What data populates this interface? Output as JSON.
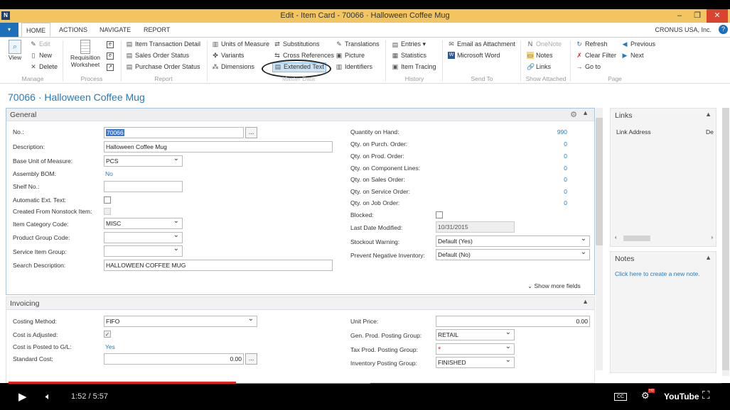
{
  "window": {
    "title": "Edit - Item Card - 70066 · Halloween Coffee Mug",
    "minimize": "–",
    "maximize": "❐",
    "close": "✕"
  },
  "ribbon_tabs": {
    "file": "▾",
    "home": "HOME",
    "actions": "ACTIONS",
    "navigate": "NAVIGATE",
    "report": "REPORT",
    "company": "CRONUS USA, Inc.",
    "help": "?"
  },
  "ribbon": {
    "manage": {
      "label": "Manage",
      "view": "View",
      "edit": "Edit",
      "new": "New",
      "delete": "Delete"
    },
    "process": {
      "label": "Process",
      "requisition": "Requisition\nWorksheet"
    },
    "report": {
      "label": "Report",
      "item_transaction_detail": "Item Transaction Detail",
      "sales_order_status": "Sales Order Status",
      "purchase_order_status": "Purchase Order Status"
    },
    "master_data": {
      "label": "Master Data",
      "units_of_measure": "Units of Measure",
      "variants": "Variants",
      "dimensions": "Dimensions",
      "substitutions": "Substitutions",
      "cross_references": "Cross References",
      "extended_text": "Extended Text",
      "translations": "Translations",
      "picture": "Picture",
      "identifiers": "Identifiers"
    },
    "history": {
      "label": "History",
      "entries": "Entries ▾",
      "statistics": "Statistics",
      "item_tracing": "Item Tracing"
    },
    "send_to": {
      "label": "Send To",
      "email_attachment": "Email as Attachment",
      "microsoft_word": "Microsoft Word"
    },
    "show_attached": {
      "label": "Show Attached",
      "onenote": "OneNote",
      "notes": "Notes",
      "links": "Links"
    },
    "page": {
      "label": "Page",
      "refresh": "Refresh",
      "clear_filter": "Clear Filter",
      "go_to": "Go to",
      "previous": "Previous",
      "next": "Next"
    }
  },
  "page_title": "70066 · Halloween Coffee Mug",
  "general": {
    "title": "General",
    "no_label": "No.:",
    "no_value": "70066",
    "no_dots": "...",
    "description_label": "Description:",
    "description_value": "Halloween Coffee Mug",
    "base_uom_label": "Base Unit of Measure:",
    "base_uom_value": "PCS",
    "assembly_bom_label": "Assembly BOM:",
    "assembly_bom_value": "No",
    "shelf_no_label": "Shelf No.:",
    "shelf_no_value": "",
    "auto_ext_text_label": "Automatic Ext. Text:",
    "created_nonstock_label": "Created From Nonstock Item:",
    "item_category_label": "Item Category Code:",
    "item_category_value": "MISC",
    "product_group_label": "Product Group Code:",
    "product_group_value": "",
    "service_item_group_label": "Service Item Group:",
    "service_item_group_value": "",
    "search_desc_label": "Search Description:",
    "search_desc_value": "HALLOWEEN COFFEE MUG",
    "qty_on_hand_label": "Quantity on Hand:",
    "qty_on_hand_value": "990",
    "qty_purch_label": "Qty. on Purch. Order:",
    "qty_purch_value": "0",
    "qty_prod_label": "Qty. on Prod. Order:",
    "qty_prod_value": "0",
    "qty_comp_label": "Qty. on Component Lines:",
    "qty_comp_value": "0",
    "qty_sales_label": "Qty. on Sales Order:",
    "qty_sales_value": "0",
    "qty_service_label": "Qty. on Service Order:",
    "qty_service_value": "0",
    "qty_job_label": "Qty. on Job Order:",
    "qty_job_value": "0",
    "blocked_label": "Blocked:",
    "last_modified_label": "Last Date Modified:",
    "last_modified_value": "10/31/2015",
    "stockout_label": "Stockout Warning:",
    "stockout_value": "Default (Yes)",
    "prevent_neg_label": "Prevent Negative Inventory:",
    "prevent_neg_value": "Default (No)",
    "show_more": "Show more fields"
  },
  "invoicing": {
    "title": "Invoicing",
    "costing_method_label": "Costing Method:",
    "costing_method_value": "FIFO",
    "cost_adjusted_label": "Cost is Adjusted:",
    "cost_adjusted_check": "✓",
    "cost_posted_label": "Cost is Posted to G/L:",
    "cost_posted_value": "Yes",
    "standard_cost_label": "Standard Cost:",
    "standard_cost_value": "0.00",
    "standard_cost_dots": "...",
    "unit_price_label": "Unit Price:",
    "unit_price_value": "0.00",
    "gen_prod_label": "Gen. Prod. Posting Group:",
    "gen_prod_value": "RETAIL",
    "tax_prod_label": "Tax Prod. Posting Group:",
    "tax_prod_value": "*",
    "inv_posting_label": "Inventory Posting Group:",
    "inv_posting_value": "FINISHED"
  },
  "links_panel": {
    "title": "Links",
    "col_address": "Link Address",
    "col_de": "De"
  },
  "notes_panel": {
    "title": "Notes",
    "create_link": "Click here to create a new note."
  },
  "player": {
    "time": "1:52 / 5:57",
    "progress": 0.319,
    "buffered": 0.507,
    "youtube": "YouTube",
    "cc": "CC",
    "hd": "HD"
  },
  "colors": {
    "accent": "#2a7ab8",
    "titlebar": "#f2c561",
    "progress": "#e62117"
  }
}
